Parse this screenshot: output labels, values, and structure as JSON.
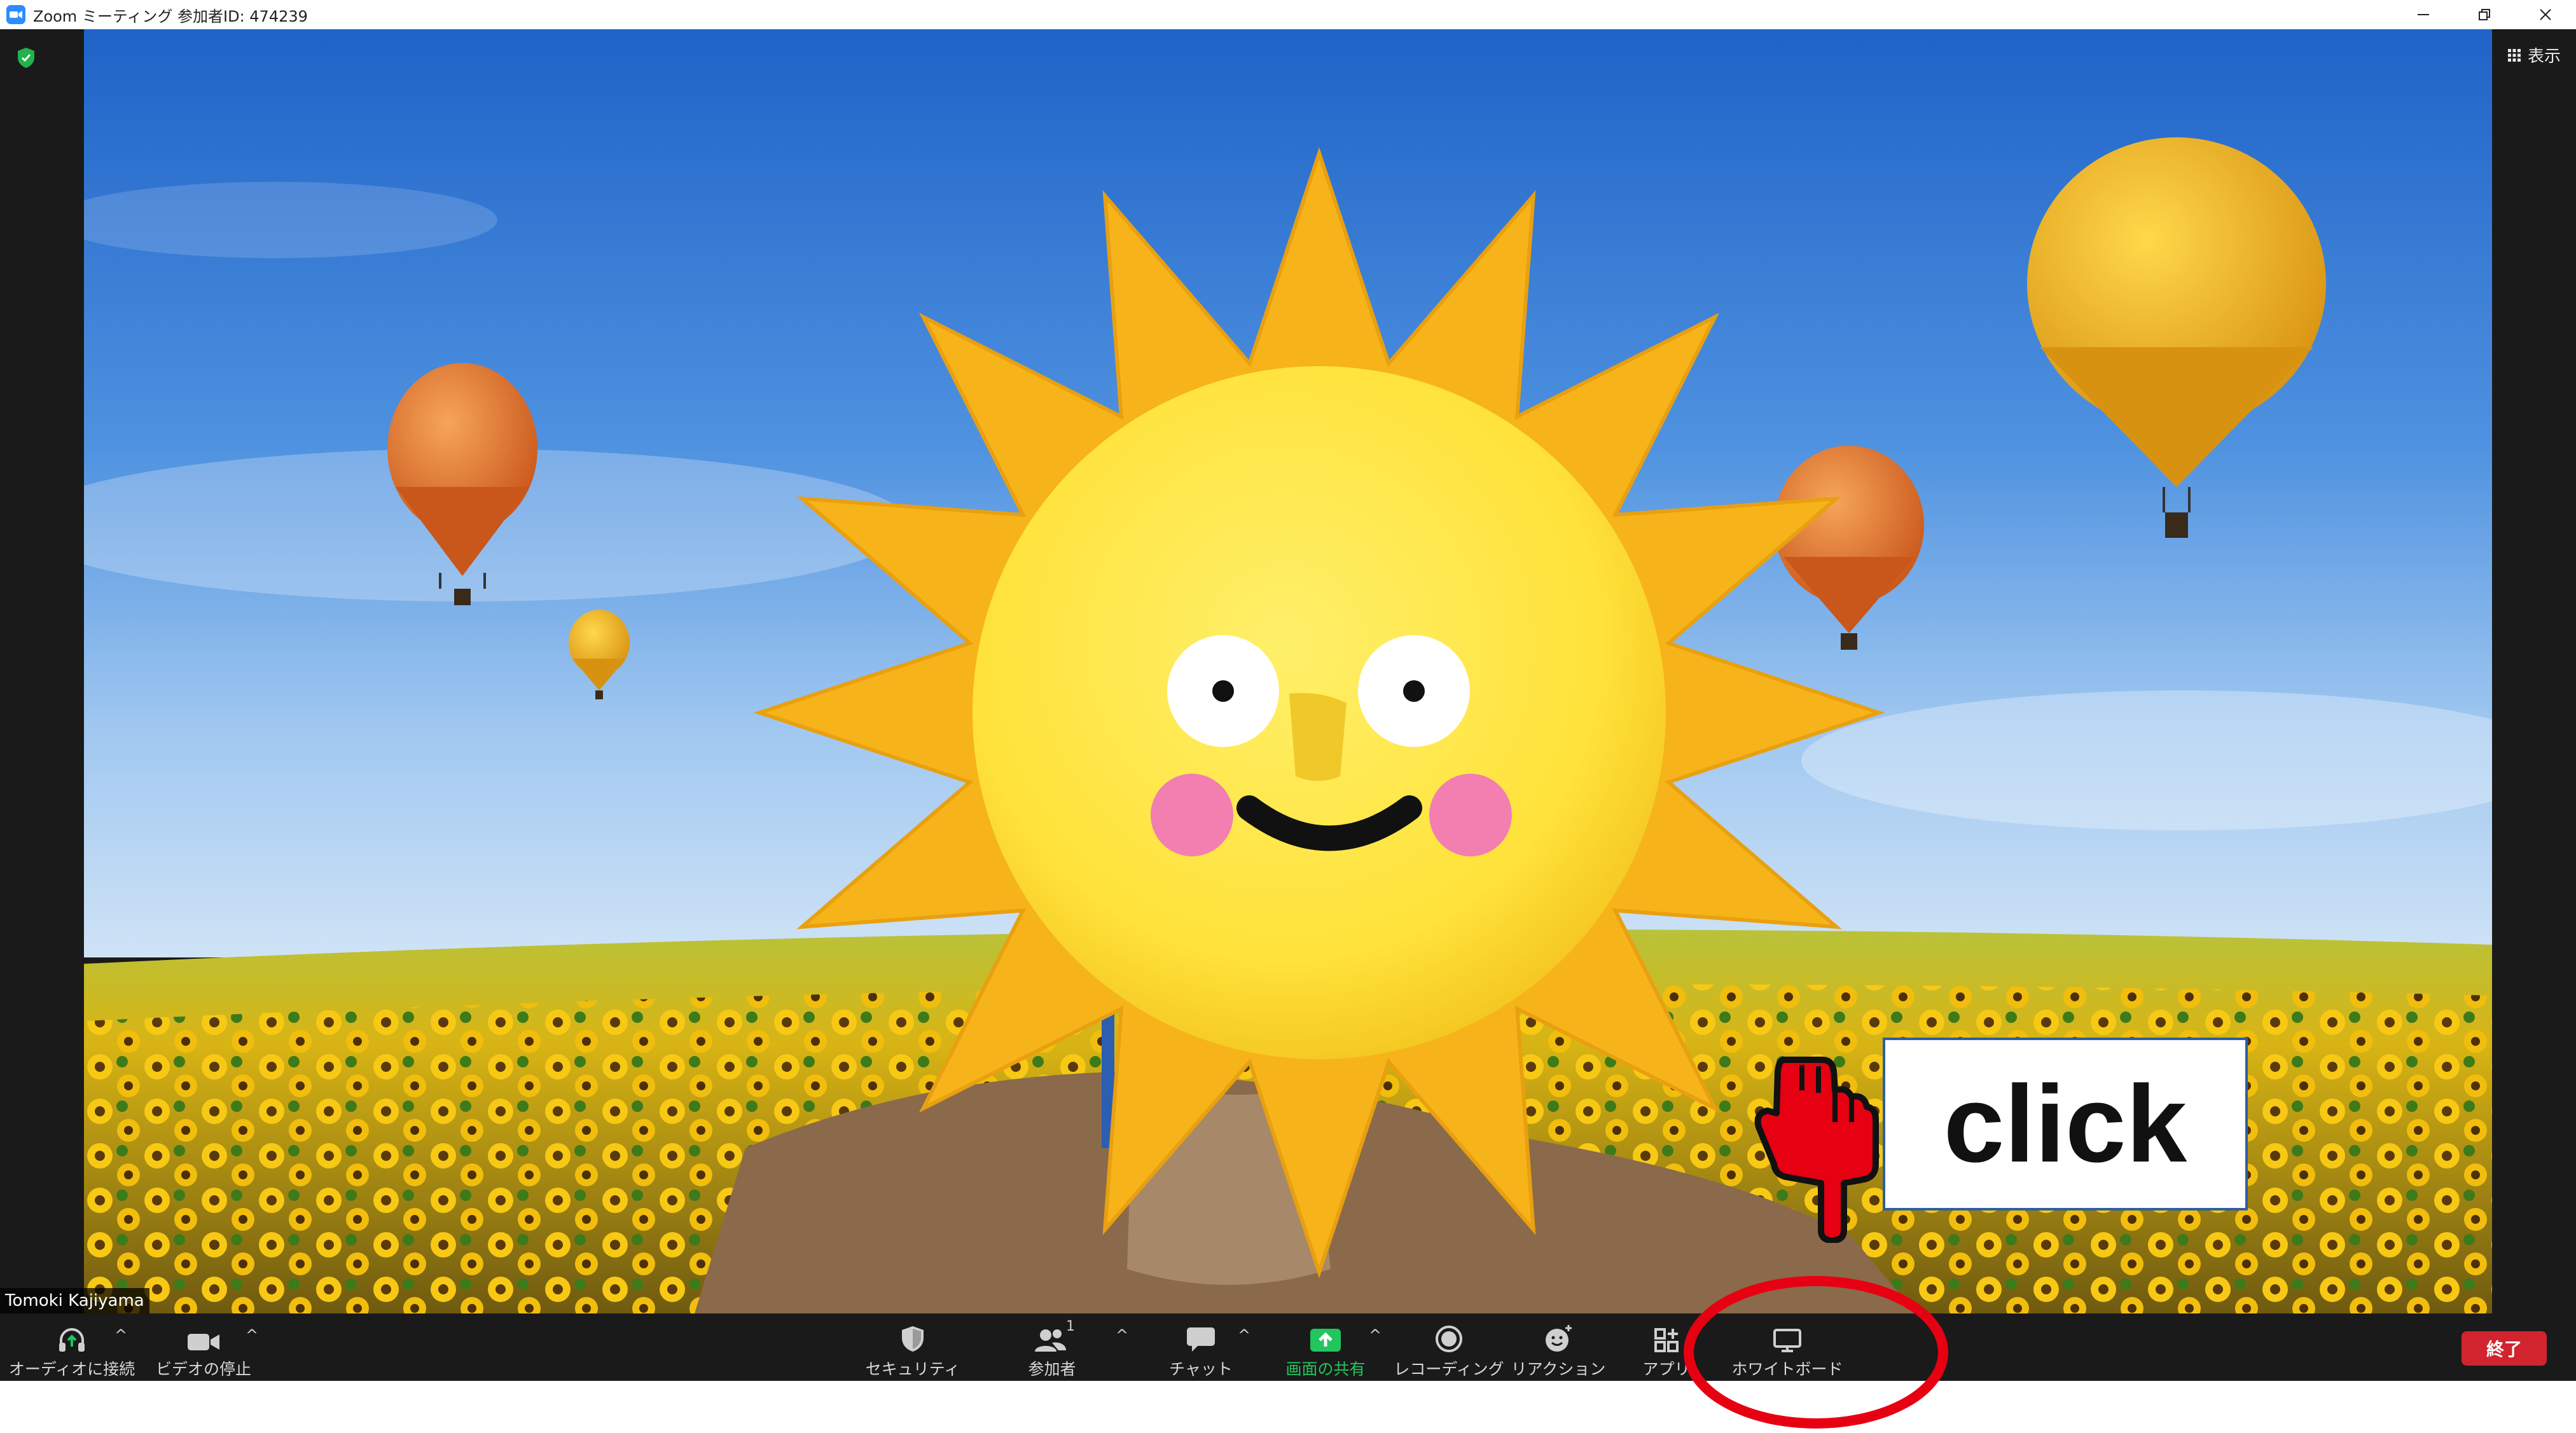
{
  "window": {
    "title": "Zoom ミーティング 参加者ID: 474239",
    "minimize_label": "minimize",
    "maximize_label": "restore",
    "close_label": "close"
  },
  "meeting": {
    "view_label": "表示",
    "participant_name": "Tomoki Kajiyama"
  },
  "toolbar": {
    "audio_label": "オーディオに接続",
    "video_label": "ビデオの停止",
    "security_label": "セキュリティ",
    "participants_label": "参加者",
    "participants_count": "1",
    "chat_label": "チャット",
    "share_label": "画面の共有",
    "record_label": "レコーディング",
    "reactions_label": "リアクション",
    "apps_label": "アプリ",
    "whiteboard_label": "ホワイトボード",
    "end_label": "終了"
  },
  "annotation": {
    "click_text": "click"
  },
  "colors": {
    "zoom_blue": "#2D8CFF",
    "toolbar_bg": "#1a1a1a",
    "share_green": "#22c55e",
    "end_red": "#d1242f",
    "annotation_red": "#e60012"
  }
}
